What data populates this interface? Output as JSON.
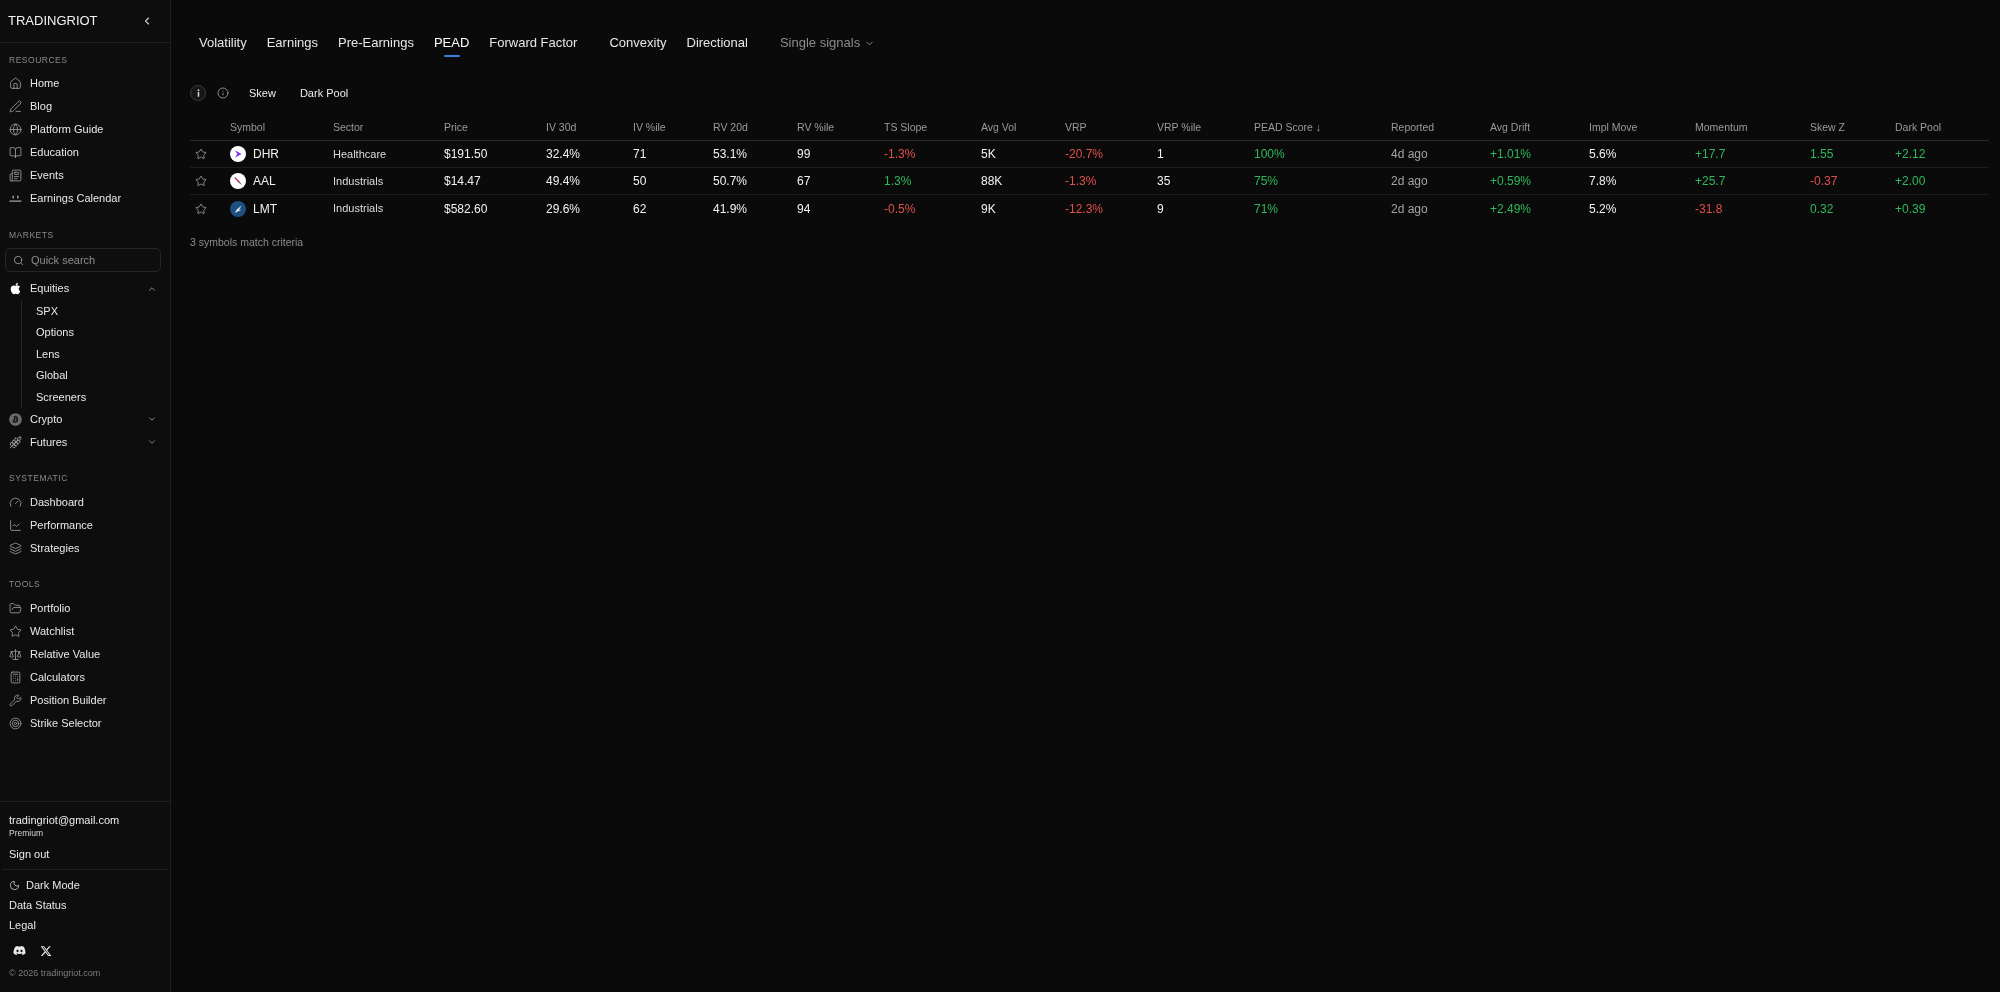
{
  "sidebar": {
    "brand": "TRADINGRIOT",
    "sections": [
      {
        "label": "RESOURCES",
        "items": [
          {
            "label": "Home"
          },
          {
            "label": "Blog"
          },
          {
            "label": "Platform Guide"
          },
          {
            "label": "Education"
          },
          {
            "label": "Events"
          },
          {
            "label": "Earnings Calendar"
          }
        ]
      },
      {
        "label": "MARKETS",
        "search": {
          "placeholder": "Quick search"
        },
        "items": [
          {
            "label": "Equities",
            "expanded": true,
            "children": [
              {
                "label": "SPX"
              },
              {
                "label": "Options"
              },
              {
                "label": "Lens"
              },
              {
                "label": "Global"
              },
              {
                "label": "Screeners"
              }
            ]
          },
          {
            "label": "Crypto",
            "expanded": false
          },
          {
            "label": "Futures",
            "expanded": false
          }
        ]
      },
      {
        "label": "SYSTEMATIC",
        "items": [
          {
            "label": "Dashboard"
          },
          {
            "label": "Performance"
          },
          {
            "label": "Strategies"
          }
        ]
      },
      {
        "label": "TOOLS",
        "items": [
          {
            "label": "Portfolio"
          },
          {
            "label": "Watchlist"
          },
          {
            "label": "Relative Value"
          },
          {
            "label": "Calculators"
          },
          {
            "label": "Position Builder"
          },
          {
            "label": "Strike Selector"
          }
        ]
      }
    ],
    "account": {
      "email": "tradingriot@gmail.com",
      "plan": "Premium",
      "sign_out": "Sign out"
    },
    "footer_links": [
      {
        "label": "Dark Mode"
      },
      {
        "label": "Data Status"
      },
      {
        "label": "Legal"
      }
    ],
    "copyright": "© 2026 tradingriot.com"
  },
  "tab_groups": [
    {
      "tabs": [
        {
          "label": "Volatility",
          "selected": false
        },
        {
          "label": "Earnings",
          "selected": false
        },
        {
          "label": "Pre-Earnings",
          "selected": false
        },
        {
          "label": "PEAD",
          "selected": true
        },
        {
          "label": "Forward Factor",
          "selected": false
        }
      ]
    },
    {
      "tabs": [
        {
          "label": "Convexity",
          "selected": false
        },
        {
          "label": "Directional",
          "selected": false
        }
      ]
    }
  ],
  "signals_dropdown": {
    "label": "Single signals"
  },
  "filters": [
    {
      "label": "Skew"
    },
    {
      "label": "Dark Pool"
    }
  ],
  "table": {
    "columns": [
      {
        "label": "Symbol",
        "kind": "symbol"
      },
      {
        "label": "Sector",
        "kind": "sector"
      },
      {
        "label": "Price",
        "kind": "number"
      },
      {
        "label": "IV 30d",
        "kind": "number"
      },
      {
        "label": "IV %ile",
        "kind": "number"
      },
      {
        "label": "RV 20d",
        "kind": "number"
      },
      {
        "label": "RV %ile",
        "kind": "number"
      },
      {
        "label": "TS Slope",
        "kind": "number"
      },
      {
        "label": "Avg Vol",
        "kind": "number"
      },
      {
        "label": "VRP",
        "kind": "number"
      },
      {
        "label": "VRP %ile",
        "kind": "number"
      },
      {
        "label": "PEAD Score ↓",
        "kind": "number"
      },
      {
        "label": "Reported",
        "kind": "date"
      },
      {
        "label": "Avg Drift",
        "kind": "number"
      },
      {
        "label": "Impl Move",
        "kind": "number"
      },
      {
        "label": "Momentum",
        "kind": "number"
      },
      {
        "label": "Skew Z",
        "kind": "number"
      },
      {
        "label": "Dark Pool",
        "kind": "number"
      }
    ],
    "rows": [
      {
        "starred": false,
        "cells": [
          {
            "text": "DHR"
          },
          {
            "text": "Healthcare"
          },
          {
            "text": "$191.50"
          },
          {
            "text": "32.4%"
          },
          {
            "text": "71"
          },
          {
            "text": "53.1%"
          },
          {
            "text": "99"
          },
          {
            "text": "-1.3%",
            "color": "#e0504d"
          },
          {
            "text": "5K"
          },
          {
            "text": "-20.7%",
            "color": "#e0504d"
          },
          {
            "text": "1"
          },
          {
            "text": "100%",
            "color": "#2fb85c"
          },
          {
            "text": "4d ago"
          },
          {
            "text": "+1.01%",
            "color": "#2fb85c"
          },
          {
            "text": "5.6%"
          },
          {
            "text": "+17.7",
            "color": "#2fb85c"
          },
          {
            "text": "1.55",
            "color": "#2fb85c"
          },
          {
            "text": "+2.12",
            "color": "#2fb85c"
          }
        ]
      },
      {
        "starred": false,
        "cells": [
          {
            "text": "AAL"
          },
          {
            "text": "Industrials"
          },
          {
            "text": "$14.47"
          },
          {
            "text": "49.4%"
          },
          {
            "text": "50"
          },
          {
            "text": "50.7%"
          },
          {
            "text": "67"
          },
          {
            "text": "1.3%",
            "color": "#2fb85c"
          },
          {
            "text": "88K"
          },
          {
            "text": "-1.3%",
            "color": "#e0504d"
          },
          {
            "text": "35"
          },
          {
            "text": "75%",
            "color": "#2fb85c"
          },
          {
            "text": "2d ago"
          },
          {
            "text": "+0.59%",
            "color": "#2fb85c"
          },
          {
            "text": "7.8%"
          },
          {
            "text": "+25.7",
            "color": "#2fb85c"
          },
          {
            "text": "-0.37",
            "color": "#e0504d"
          },
          {
            "text": "+2.00",
            "color": "#2fb85c"
          }
        ]
      },
      {
        "starred": false,
        "cells": [
          {
            "text": "LMT"
          },
          {
            "text": "Industrials"
          },
          {
            "text": "$582.60"
          },
          {
            "text": "29.6%"
          },
          {
            "text": "62"
          },
          {
            "text": "41.9%"
          },
          {
            "text": "94"
          },
          {
            "text": "-0.5%",
            "color": "#e0504d"
          },
          {
            "text": "9K"
          },
          {
            "text": "-12.3%",
            "color": "#e0504d"
          },
          {
            "text": "9"
          },
          {
            "text": "71%",
            "color": "#2fb85c"
          },
          {
            "text": "2d ago"
          },
          {
            "text": "+2.49%",
            "color": "#2fb85c"
          },
          {
            "text": "5.2%"
          },
          {
            "text": "-31.8",
            "color": "#e0504d"
          },
          {
            "text": "0.32",
            "color": "#2fb85c"
          },
          {
            "text": "+0.39",
            "color": "#2fb85c"
          }
        ]
      }
    ]
  },
  "result_note": "3 symbols match criteria"
}
